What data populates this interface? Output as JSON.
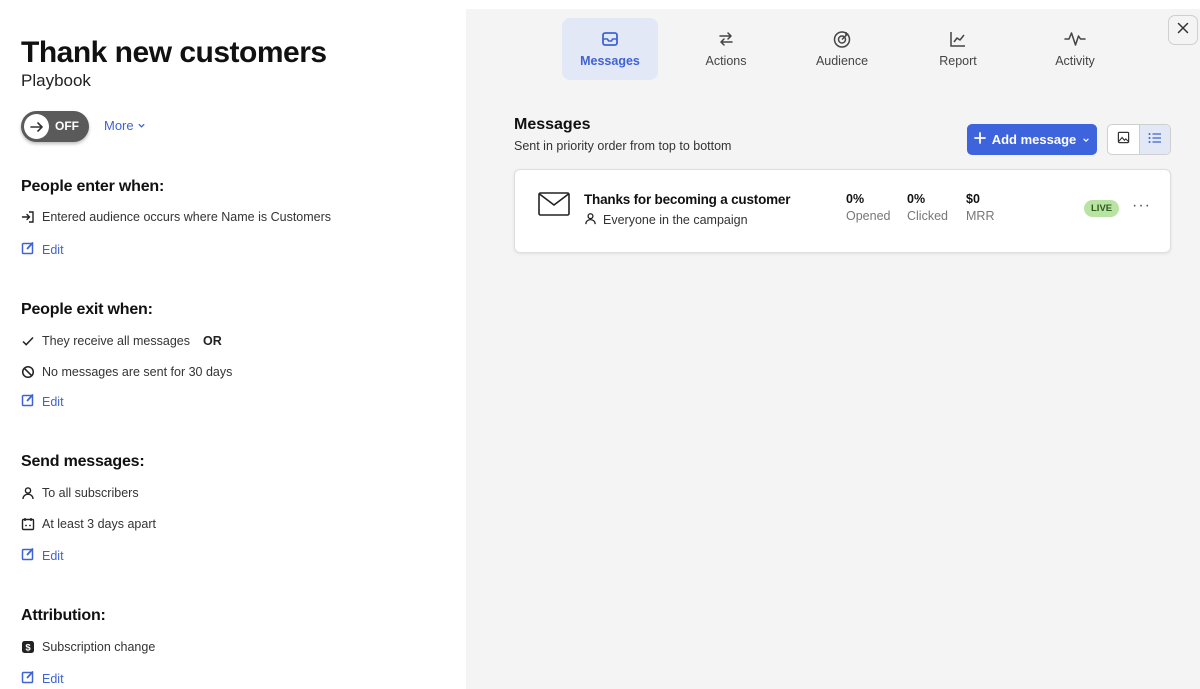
{
  "header": {
    "title": "Thank new customers",
    "subtitle": "Playbook",
    "toggle_label": "OFF",
    "more_label": "More"
  },
  "entry": {
    "heading": "People enter when:",
    "condition": "Entered audience occurs where Name is Customers",
    "edit_label": "Edit"
  },
  "exit": {
    "heading": "People exit when:",
    "condition_1": "They receive all messages",
    "or_label": "OR",
    "condition_2": "No messages are sent for 30 days",
    "edit_label": "Edit"
  },
  "send": {
    "heading": "Send messages:",
    "recipients": "To all subscribers",
    "frequency": "At least 3 days apart",
    "edit_label": "Edit"
  },
  "attribution": {
    "heading": "Attribution:",
    "source": "Subscription change",
    "edit_label": "Edit"
  },
  "nav": {
    "tabs": [
      {
        "label": "Messages",
        "icon": "inbox-icon",
        "active": true
      },
      {
        "label": "Actions",
        "icon": "arrows-swap-icon",
        "active": false
      },
      {
        "label": "Audience",
        "icon": "target-icon",
        "active": false
      },
      {
        "label": "Report",
        "icon": "line-chart-icon",
        "active": false
      },
      {
        "label": "Activity",
        "icon": "pulse-icon",
        "active": false
      }
    ]
  },
  "messages": {
    "title": "Messages",
    "subtitle": "Sent in priority order from top to bottom",
    "add_button_label": "Add message",
    "items": [
      {
        "title": "Thanks for becoming a customer",
        "audience": "Everyone in the campaign",
        "stats": [
          {
            "value": "0%",
            "label": "Opened"
          },
          {
            "value": "0%",
            "label": "Clicked"
          },
          {
            "value": "$0",
            "label": "MRR"
          }
        ],
        "status": "LIVE"
      }
    ]
  },
  "colors": {
    "accent": "#3d63dd",
    "live_badge": "#b9e3a2",
    "right_panel_bg": "#f4f4f4"
  }
}
